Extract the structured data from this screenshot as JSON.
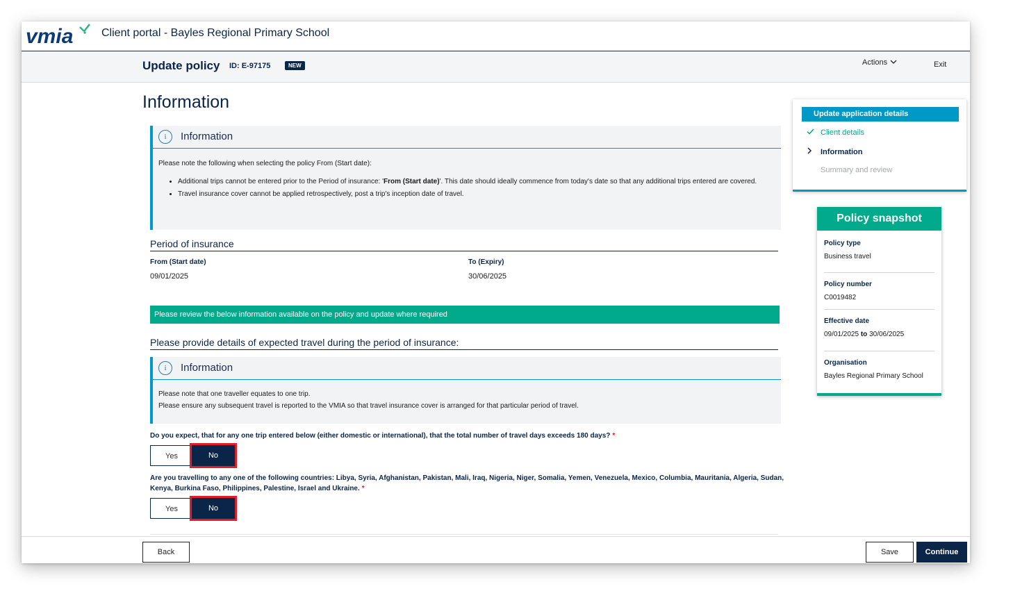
{
  "header": {
    "logo_text": "vmia",
    "portal_title": "Client portal - Bayles Regional Primary School"
  },
  "subheader": {
    "title": "Update policy",
    "id_label": "ID: E-97175",
    "badge": "NEW",
    "actions_label": "Actions",
    "exit_label": "Exit"
  },
  "page": {
    "title": "Information"
  },
  "info_box_1": {
    "title": "Information",
    "intro": "Please note the following when selecting the policy From (Start date):",
    "bullet1_pre": "Additional trips cannot be entered prior to the Period of insurance: '",
    "bullet1_bold": "From (Start date)",
    "bullet1_post": "'. This date should ideally commence from today's date so that any additional trips entered are covered.",
    "bullet2": "Travel insurance cover cannot be applied retrospectively, post a trip's inception date of travel."
  },
  "period": {
    "heading": "Period of insurance",
    "from_label": "From (Start date)",
    "from_value": "09/01/2025",
    "to_label": "To (Expiry)",
    "to_value": "30/06/2025"
  },
  "notice_bar": "Please review the below information available on the policy and update where required",
  "travel": {
    "heading": "Please provide details of expected travel during the period of insurance:"
  },
  "info_box_2": {
    "title": "Information",
    "line1": "Please note that one traveller equates to one trip.",
    "line2": "Please ensure any subsequent travel is reported to the VMIA so that travel insurance cover is arranged for that particular period of travel."
  },
  "question1": {
    "text": "Do you expect, that for any one trip entered below (either domestic or international), that the total number of travel days exceeds 180 days?",
    "required_mark": "*",
    "yes_label": "Yes",
    "no_label": "No",
    "selected": "No"
  },
  "question2": {
    "text": "Are you travelling to any one of the following countries: Libya, Syria, Afghanistan, Pakistan, Mali, Iraq, Nigeria, Niger, Somalia, Yemen, Venezuela, Mexico, Columbia, Mauritania, Algeria, Sudan, Kenya, Burkina Faso, Philippines, Palestine, Israel and Ukraine.",
    "required_mark": "*",
    "yes_label": "Yes",
    "no_label": "No",
    "selected": "No"
  },
  "steps": {
    "header": "Update application details",
    "items": [
      {
        "label": "Client details",
        "status": "done"
      },
      {
        "label": "Information",
        "status": "current"
      },
      {
        "label": "Summary and review",
        "status": "upcoming"
      }
    ]
  },
  "snapshot": {
    "title": "Policy snapshot",
    "policy_type_label": "Policy type",
    "policy_type_value": "Business travel",
    "policy_number_label": "Policy number",
    "policy_number_value": "C0019482",
    "effective_label": "Effective date",
    "effective_from": "09/01/2025",
    "effective_to_word": "to",
    "effective_to": "30/06/2025",
    "organisation_label": "Organisation",
    "organisation_value": "Bayles Regional Primary School"
  },
  "footer": {
    "back_label": "Back",
    "save_label": "Save",
    "continue_label": "Continue"
  },
  "colors": {
    "navy": "#0b2548",
    "teal": "#00aa8a",
    "blue": "#0098c7",
    "highlight": "#e01e2a"
  }
}
